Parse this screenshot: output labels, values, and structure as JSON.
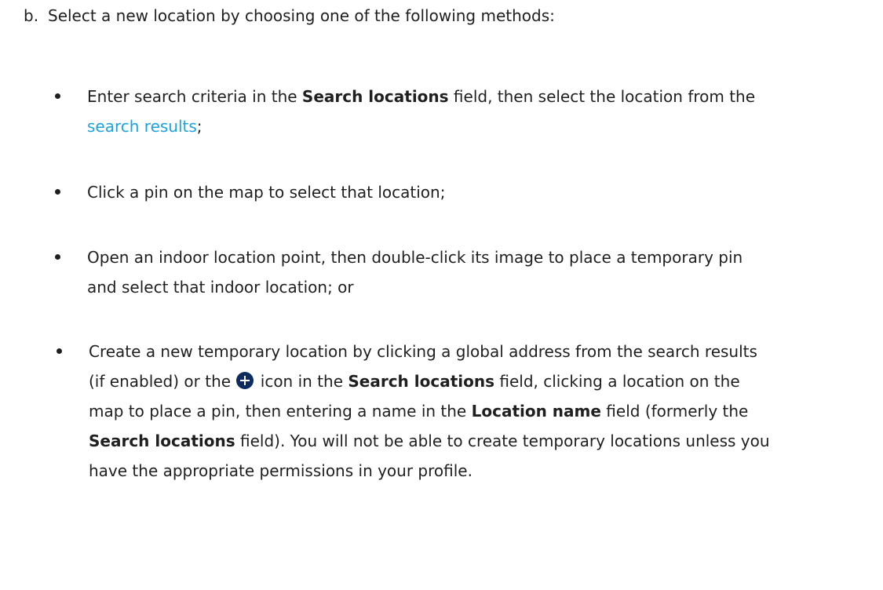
{
  "step": {
    "marker": "b.",
    "text": "Select a new location by choosing one of the following methods:"
  },
  "bullets": [
    {
      "lines": [
        {
          "p1": "Enter search criteria in the ",
          "b1": "Search locations",
          "p2": " field, then select the location from the"
        },
        {
          "link": "search results",
          "p1": ";"
        }
      ]
    },
    {
      "lines": [
        {
          "p1": "Click a pin on the map to select that location;"
        }
      ]
    },
    {
      "lines": [
        {
          "p1": "Open an indoor location point, then double-click its image to place a temporary pin"
        },
        {
          "p1": "and select that indoor location; or"
        }
      ]
    },
    {
      "lines": [
        {
          "p1": "Create a new temporary location by clicking a global address from the search results"
        },
        {
          "p1": "(if enabled) or the ",
          "icon": "plus-circle-icon",
          "p2": " icon in the ",
          "b1": "Search locations",
          "p3": " field, clicking a location on the"
        },
        {
          "p1": "map to place a pin, then entering a name in the ",
          "b1": "Location name",
          "p2": " field (formerly the"
        },
        {
          "b1": "Search locations",
          "p1": " field). You will not be able to create temporary locations unless you"
        },
        {
          "p1": "have the appropriate permissions in your profile."
        }
      ]
    }
  ],
  "colors": {
    "text": "#1f1f1f",
    "link": "#1aa3dc",
    "icon_fill": "#0d2b5e"
  }
}
